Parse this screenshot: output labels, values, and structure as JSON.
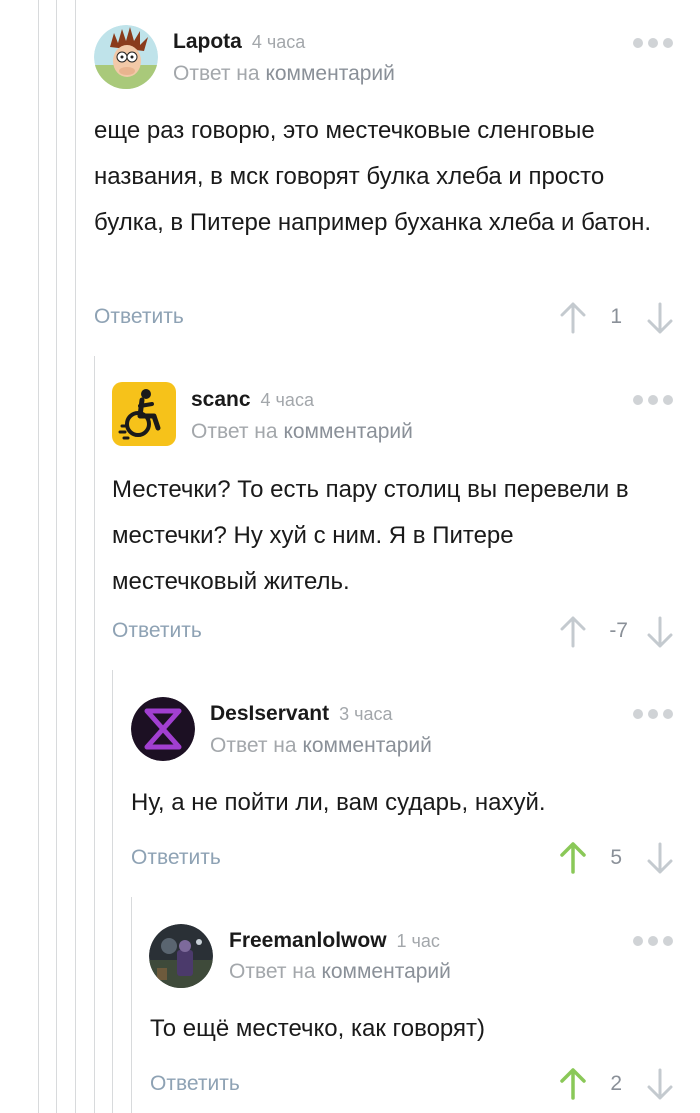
{
  "comments": [
    {
      "username": "Lapota",
      "time": "4 часа",
      "reply_prefix": "Ответ на",
      "reply_link": "комментарий",
      "text": "еще раз говорю, это местечковые сленговые названия, в мск говорят булка хлеба и просто булка, в Питере например буханка хлеба и батон.",
      "reply_label": "Ответить",
      "rating": "1",
      "upvoted": false
    },
    {
      "username": "scanc",
      "time": "4 часа",
      "reply_prefix": "Ответ на",
      "reply_link": "комментарий",
      "text": "Местечки? То есть пару столиц вы перевели в местечки? Ну хуй с ним. Я в Питере местечковый житель.",
      "reply_label": "Ответить",
      "rating": "-7",
      "upvoted": false
    },
    {
      "username": "DesIservant",
      "time": "3 часа",
      "reply_prefix": "Ответ на",
      "reply_link": "комментарий",
      "text": "Ну, а не пойти ли, вам сударь, нахуй.",
      "reply_label": "Ответить",
      "rating": "5",
      "upvoted": true
    },
    {
      "username": "Freemanlolwow",
      "time": "1 час",
      "reply_prefix": "Ответ на",
      "reply_link": "комментарий",
      "text": "То ещё местечко, как говорят)",
      "reply_label": "Ответить",
      "rating": "2",
      "upvoted": true
    }
  ],
  "colors": {
    "upvote_active": "#8ac858",
    "vote_inactive": "#c4cacf",
    "thread_line": "#d8dadc",
    "reply_link": "#8ea2b4"
  },
  "icons": {
    "more": "more-dots-icon",
    "up": "arrow-up-icon",
    "down": "arrow-down-icon"
  }
}
